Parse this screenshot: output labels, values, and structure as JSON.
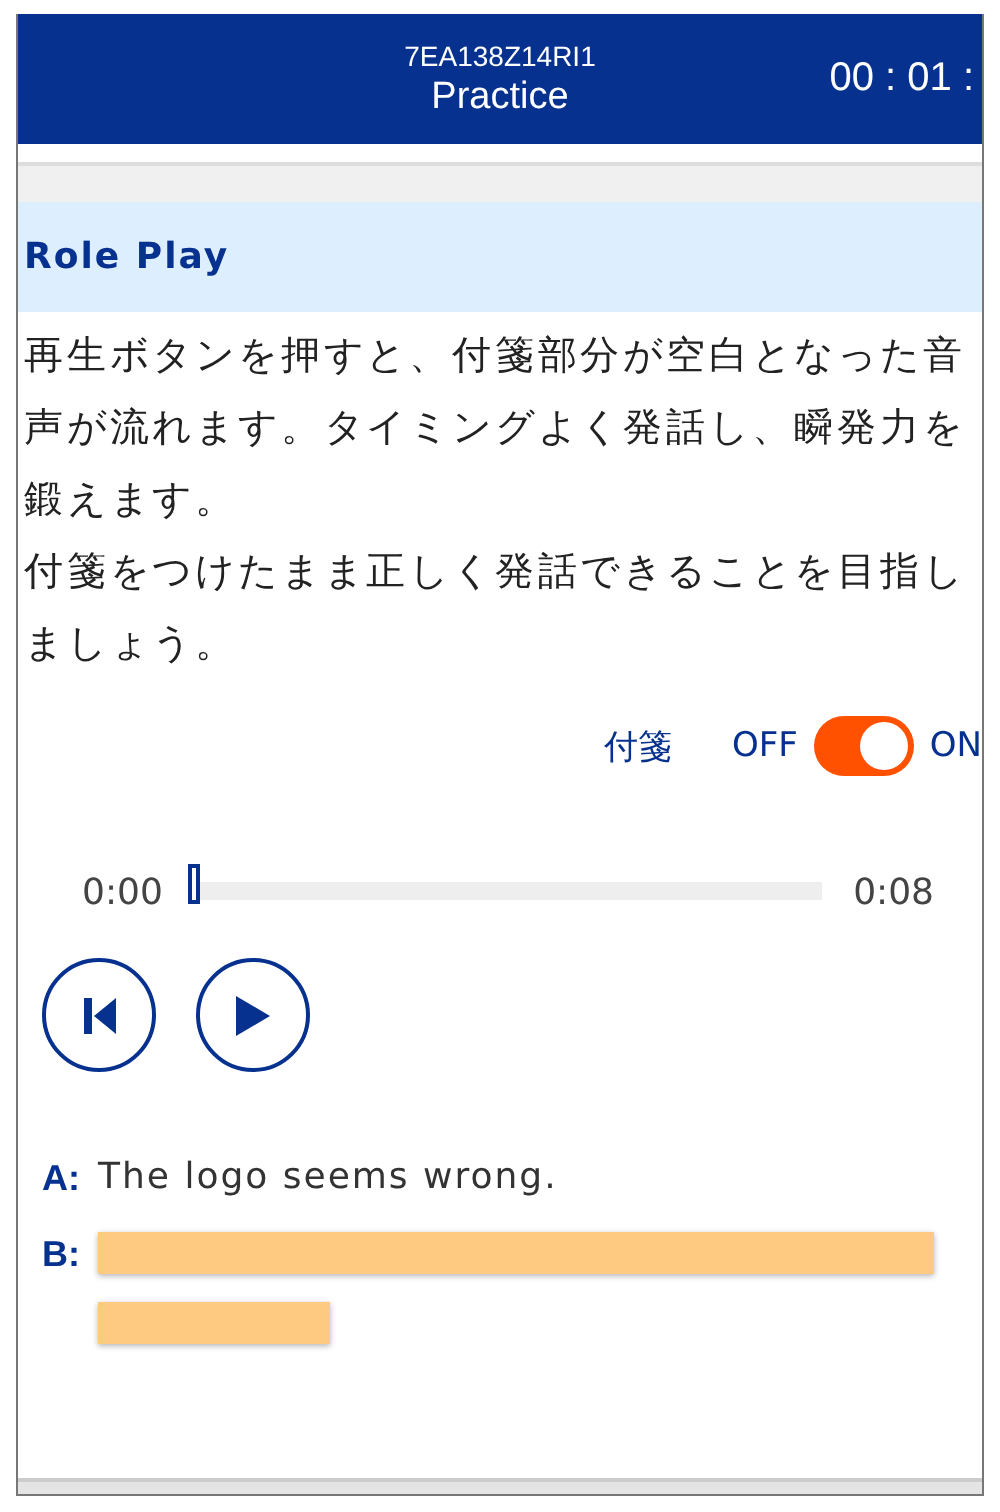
{
  "header": {
    "code": "7EA138Z14RI1",
    "title": "Practice",
    "timer": "00 : 01 :"
  },
  "section_title": "Role Play",
  "description": [
    "再生ボタンを押すと、付箋部分が空白となった音声が流れます。タイミングよく発話し、瞬発力を鍛えます。",
    "付箋をつけたまま正しく発話できることを目指しましょう。"
  ],
  "toggle": {
    "label": "付箋",
    "off_label": "OFF",
    "on_label": "ON",
    "on": true
  },
  "player": {
    "current": "0:00",
    "total": "0:08",
    "level": 0
  },
  "dialogue": [
    {
      "speaker": "A:",
      "text": "The logo seems wrong.",
      "covered": false
    },
    {
      "speaker": "B:",
      "covered": true,
      "notes": [
        {
          "kind": "long"
        },
        {
          "kind": "short"
        }
      ]
    }
  ]
}
